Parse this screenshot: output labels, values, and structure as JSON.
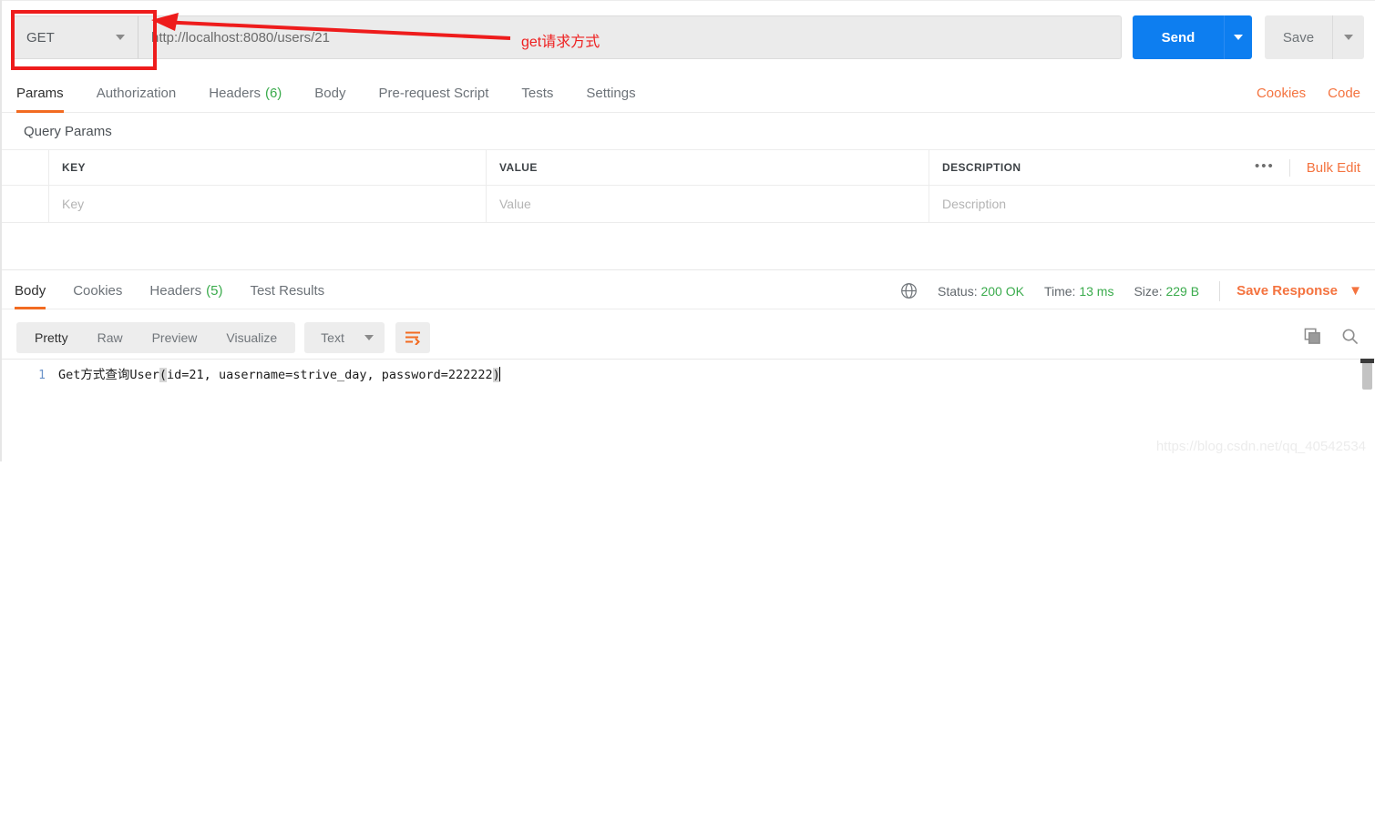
{
  "request_bar": {
    "method": "GET",
    "method_caret_icon": "chevron-down-icon",
    "url": "http://localhost:8080/users/21",
    "send_label": "Send",
    "send_caret_icon": "chevron-down-icon",
    "save_label": "Save",
    "save_caret_icon": "chevron-down-icon"
  },
  "annotation": {
    "text": "get请求方式",
    "color": "#ee2020",
    "box_color": "#ee1c1c",
    "arrow_icon": "arrow-left-icon"
  },
  "request_tabs": {
    "items": [
      {
        "label": "Params",
        "count": "",
        "active": true
      },
      {
        "label": "Authorization",
        "count": "",
        "active": false
      },
      {
        "label": "Headers",
        "count": "(6)",
        "active": false
      },
      {
        "label": "Body",
        "count": "",
        "active": false
      },
      {
        "label": "Pre-request Script",
        "count": "",
        "active": false
      },
      {
        "label": "Tests",
        "count": "",
        "active": false
      },
      {
        "label": "Settings",
        "count": "",
        "active": false
      }
    ],
    "cookies_link": "Cookies",
    "code_link": "Code"
  },
  "query_params": {
    "section_label": "Query Params",
    "columns": [
      "KEY",
      "VALUE",
      "DESCRIPTION"
    ],
    "row_placeholders": [
      "Key",
      "Value",
      "Description"
    ],
    "more_icon": "ellipsis-icon",
    "bulk_edit_label": "Bulk Edit"
  },
  "response_tabs": {
    "items": [
      {
        "label": "Body",
        "count": "",
        "active": true
      },
      {
        "label": "Cookies",
        "count": "",
        "active": false
      },
      {
        "label": "Headers",
        "count": "(5)",
        "active": false
      },
      {
        "label": "Test Results",
        "count": "",
        "active": false
      }
    ],
    "globe_icon": "globe-icon",
    "status_label": "Status:",
    "status_value": "200 OK",
    "time_label": "Time:",
    "time_value": "13 ms",
    "size_label": "Size:",
    "size_value": "229 B",
    "save_response_label": "Save Response",
    "save_response_caret_icon": "chevron-down-icon",
    "value_color": "#3aab4c"
  },
  "body_toolbar": {
    "views": [
      {
        "label": "Pretty",
        "active": true
      },
      {
        "label": "Raw",
        "active": false
      },
      {
        "label": "Preview",
        "active": false
      },
      {
        "label": "Visualize",
        "active": false
      }
    ],
    "format_value": "Text",
    "format_caret_icon": "chevron-down-icon",
    "wrap_icon": "word-wrap-icon",
    "copy_icon": "copy-icon",
    "search_icon": "search-icon"
  },
  "response_body": {
    "line_number": "1",
    "segments": {
      "before": "Get方式查询User",
      "open_paren": "(",
      "middle": "id=21, uasername=strive_day, password=222222",
      "close_paren": ")"
    },
    "full_text": "Get方式查询User(id=21, uasername=strive_day, password=222222)"
  },
  "watermark": {
    "text": "https://blog.csdn.net/qq_40542534"
  }
}
